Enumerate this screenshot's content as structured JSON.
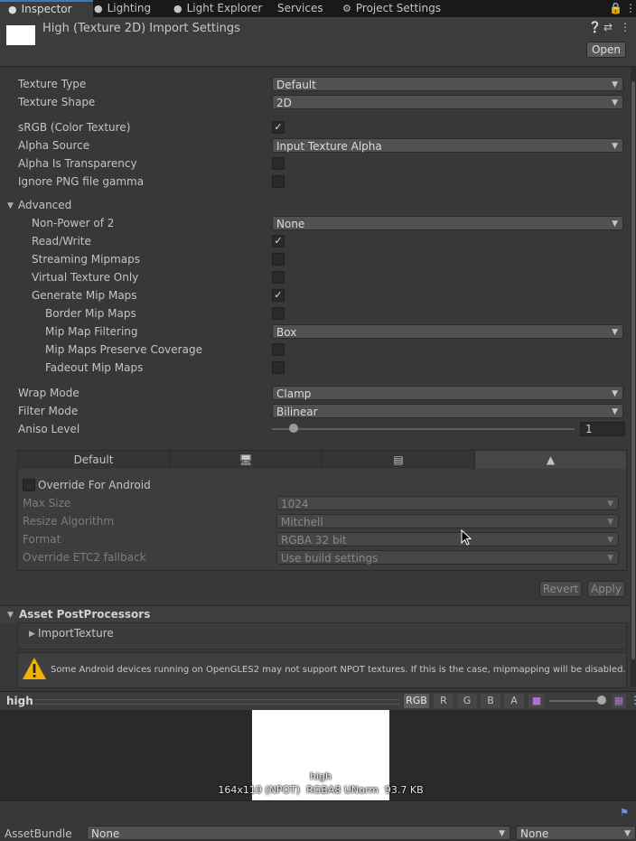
{
  "tabs": [
    {
      "label": "Inspector",
      "icon": "info-icon"
    },
    {
      "label": "Lighting",
      "icon": "bulb-icon"
    },
    {
      "label": "Light Explorer",
      "icon": "bulb-icon"
    },
    {
      "label": "Services",
      "icon": ""
    },
    {
      "label": "Project Settings",
      "icon": "gear-icon"
    }
  ],
  "header": {
    "title": "High (Texture 2D) Import Settings",
    "open_label": "Open"
  },
  "fields": {
    "texture_type": {
      "label": "Texture Type",
      "value": "Default"
    },
    "texture_shape": {
      "label": "Texture Shape",
      "value": "2D"
    },
    "srgb": {
      "label": "sRGB (Color Texture)",
      "checked": true
    },
    "alpha_source": {
      "label": "Alpha Source",
      "value": "Input Texture Alpha"
    },
    "alpha_transparency": {
      "label": "Alpha Is Transparency",
      "checked": false
    },
    "ignore_png_gamma": {
      "label": "Ignore PNG file gamma",
      "checked": false
    },
    "advanced": {
      "label": "Advanced"
    },
    "non_power_of_2": {
      "label": "Non-Power of 2",
      "value": "None"
    },
    "read_write": {
      "label": "Read/Write",
      "checked": true
    },
    "streaming_mipmaps": {
      "label": "Streaming Mipmaps",
      "checked": false
    },
    "virtual_texture_only": {
      "label": "Virtual Texture Only",
      "checked": false
    },
    "generate_mip_maps": {
      "label": "Generate Mip Maps",
      "checked": true
    },
    "border_mip_maps": {
      "label": "Border Mip Maps",
      "checked": false
    },
    "mip_map_filtering": {
      "label": "Mip Map Filtering",
      "value": "Box"
    },
    "mip_maps_preserve_coverage": {
      "label": "Mip Maps Preserve Coverage",
      "checked": false
    },
    "fadeout_mip_maps": {
      "label": "Fadeout Mip Maps",
      "checked": false
    },
    "wrap_mode": {
      "label": "Wrap Mode",
      "value": "Clamp"
    },
    "filter_mode": {
      "label": "Filter Mode",
      "value": "Bilinear"
    },
    "aniso_level": {
      "label": "Aniso Level",
      "value": "1",
      "slider_fraction": 0.0
    }
  },
  "platform": {
    "tabs": [
      {
        "label": "Default",
        "icon": ""
      },
      {
        "label": "",
        "icon": "monitor-icon"
      },
      {
        "label": "",
        "icon": "server-icon"
      },
      {
        "label": "",
        "icon": "android-icon"
      }
    ],
    "override_label": "Override For Android",
    "override_checked": false,
    "rows": [
      {
        "label": "Max Size",
        "value": "1024"
      },
      {
        "label": "Resize Algorithm",
        "value": "Mitchell"
      },
      {
        "label": "Format",
        "value": "RGBA 32 bit"
      },
      {
        "label": "Override ETC2 fallback",
        "value": "Use build settings"
      }
    ],
    "revert_label": "Revert",
    "apply_label": "Apply"
  },
  "postprocessors": {
    "title": "Asset PostProcessors",
    "item": "ImportTexture"
  },
  "warning": "Some Android devices running on OpenGLES2 may not support NPOT textures. If this is the case, mipmapping will be disabled.",
  "preview": {
    "name": "high",
    "channels": [
      "RGB",
      "R",
      "G",
      "B",
      "A"
    ],
    "image_name": "high",
    "info": "164x110 (NPOT)  RGBA8 UNorm  93.7 KB"
  },
  "assetbundle": {
    "label": "AssetBundle",
    "name_value": "None",
    "variant_value": "None"
  },
  "colors": {
    "accent": "#3a79bb",
    "warning": "#f0b400",
    "background": "#383838"
  }
}
